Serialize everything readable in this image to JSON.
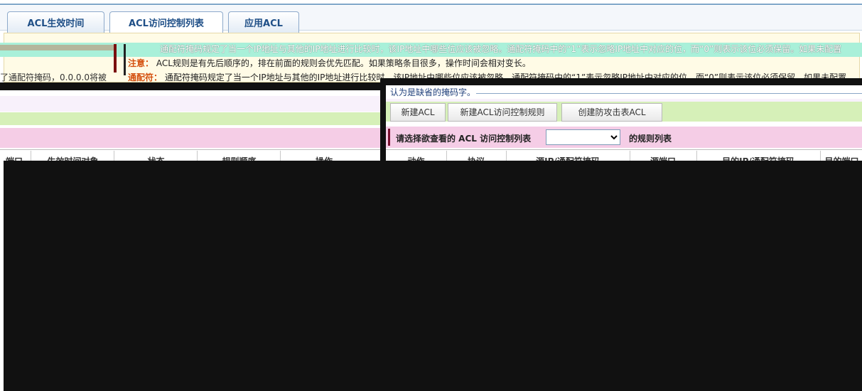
{
  "tabs": [
    {
      "label": "ACL生效时间",
      "active": false
    },
    {
      "label": "ACL访问控制列表",
      "active": true
    },
    {
      "label": "应用ACL",
      "active": false
    }
  ],
  "notice": {
    "note_label": "注意：",
    "note_text": "ACL规则是有先后顺序的，排在前面的规则会优先匹配。如果策略条目很多，操作时间会相对变长。",
    "wildcard_label": "通配符：",
    "wildcard_text": "通配符掩码规定了当一个IP地址与其他的IP地址进行比较时，该IP地址中哪些位应该被忽略。通配符掩码中的“1”表示忽略IP地址中对应的位，而“0”则表示该位必须保留。如果未配置",
    "left_fragment": "了通配符掩码，0.0.0.0将被",
    "default_note": "认为是缺省的掩码字。"
  },
  "buttons": {
    "new_acl": "新建ACL",
    "new_rule": "新建ACL访问控制规则",
    "create_antiattack": "创建防攻击表ACL"
  },
  "selector": {
    "prefix": "请选择欲查看的 ACL 访问控制列表",
    "suffix": "的规则列表",
    "selected": ""
  },
  "left_table": {
    "headers": [
      "端口",
      "生效时间对象",
      "状态",
      "规则顺序",
      "操作"
    ]
  },
  "right_table": {
    "headers": [
      "动作",
      "协议",
      "源IP/通配符掩码",
      "源端口",
      "目的IP/通配符掩码",
      "目的端口"
    ]
  }
}
